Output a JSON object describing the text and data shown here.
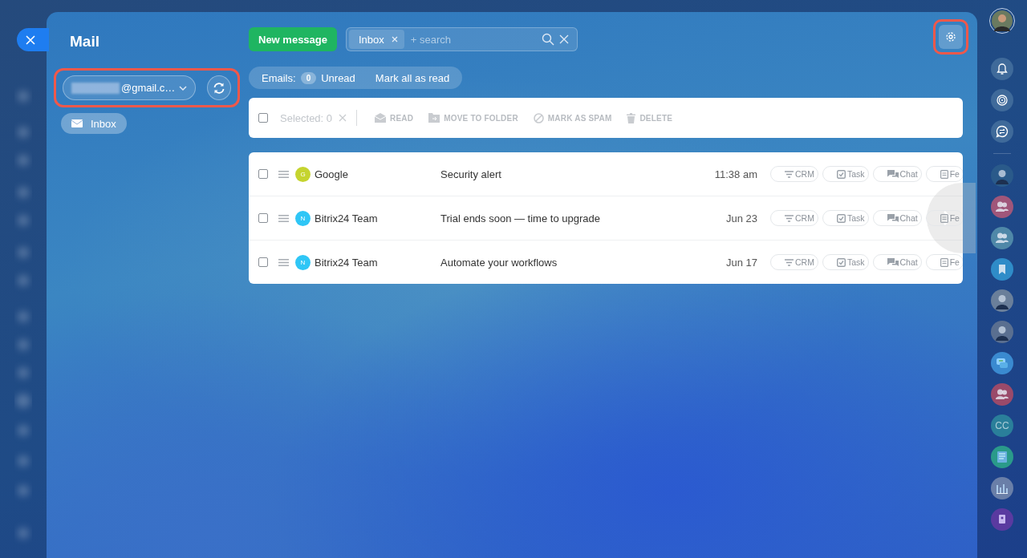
{
  "title": "Mail",
  "account": {
    "email": "@gmail.c…",
    "highlighted": true
  },
  "folders": [
    {
      "label": "Inbox",
      "selected": true
    }
  ],
  "new_message_button": "New message",
  "search": {
    "filter_chip": "Inbox",
    "placeholder": "+ search"
  },
  "settings": {
    "highlighted": true
  },
  "counters": {
    "label": "Emails:",
    "unread_count": "0",
    "unread_label": "Unread",
    "mark_all": "Mark all as read"
  },
  "toolbar": {
    "checked": false,
    "disabled": true,
    "selected_text": "Selected: 0",
    "actions": [
      {
        "kind": "read",
        "label": "READ"
      },
      {
        "kind": "folder",
        "label": "MOVE TO FOLDER"
      },
      {
        "kind": "spam",
        "label": "MARK AS SPAM"
      },
      {
        "kind": "delete",
        "label": "DELETE"
      }
    ]
  },
  "emails": [
    {
      "checked": false,
      "avatar": "G",
      "color": "#c5d42f",
      "sender": "Google",
      "subject": "Security alert",
      "date": "11:38 am",
      "actions": [
        {
          "kind": "crm",
          "label": "CRM"
        },
        {
          "kind": "task",
          "label": "Task"
        },
        {
          "kind": "chat",
          "label": "Chat"
        },
        {
          "kind": "feed",
          "label": "Fe"
        }
      ]
    },
    {
      "checked": false,
      "avatar": "N",
      "color": "#2fc6f6",
      "sender": "Bitrix24 Team",
      "subject": "Trial ends soon — time to upgrade",
      "date": "Jun 23",
      "actions": [
        {
          "kind": "crm",
          "label": "CRM"
        },
        {
          "kind": "task",
          "label": "Task"
        },
        {
          "kind": "chat",
          "label": "Chat"
        },
        {
          "kind": "feed",
          "label": "Fe"
        }
      ]
    },
    {
      "checked": false,
      "avatar": "N",
      "color": "#2fc6f6",
      "sender": "Bitrix24 Team",
      "subject": "Automate your workflows",
      "date": "Jun 17",
      "actions": [
        {
          "kind": "crm",
          "label": "CRM"
        },
        {
          "kind": "task",
          "label": "Task"
        },
        {
          "kind": "chat",
          "label": "Chat"
        },
        {
          "kind": "feed",
          "label": "Fe"
        }
      ]
    }
  ],
  "right_sidebar": [
    {
      "kind": "bell",
      "color": "#3f6a9a"
    },
    {
      "kind": "activity",
      "color": "#3f6a9a"
    },
    {
      "kind": "swap-chat",
      "color": "#3f6a9a"
    },
    {
      "kind": "divider"
    },
    {
      "kind": "person",
      "color": "#2a5a8a"
    },
    {
      "kind": "group",
      "color": "#a0567a"
    },
    {
      "kind": "group",
      "color": "#4f88a8"
    },
    {
      "kind": "bookmark",
      "color": "#2f8cc8"
    },
    {
      "kind": "person",
      "color": "#6a7f9a"
    },
    {
      "kind": "person",
      "color": "#5a6f90"
    },
    {
      "kind": "messages",
      "color": "#3a8ad0"
    },
    {
      "kind": "group",
      "color": "#9a4a6a"
    },
    {
      "kind": "initials",
      "color": "#2a7f9a",
      "text": "CC"
    },
    {
      "kind": "news",
      "color": "#2a9a8a"
    },
    {
      "kind": "chart",
      "color": "#6a7fa8"
    },
    {
      "kind": "contacts",
      "color": "#5a3aa0"
    }
  ]
}
